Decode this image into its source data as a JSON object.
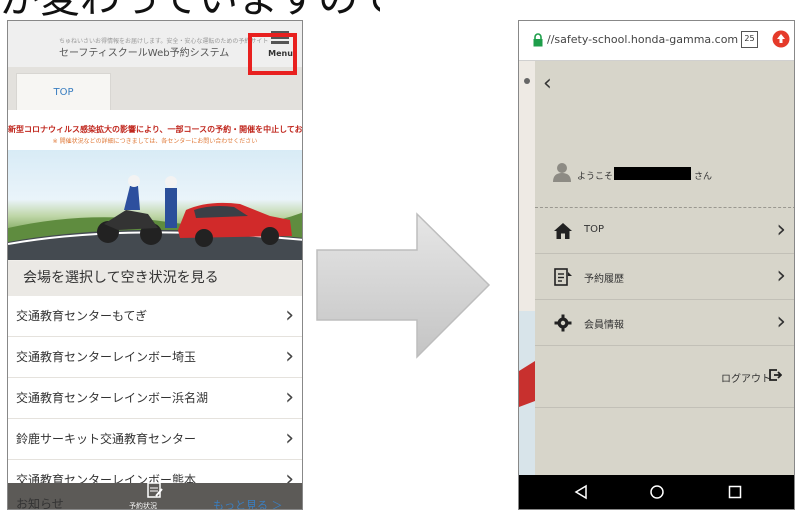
{
  "caption": "が変わっていますのでご注意ください。",
  "left_phone": {
    "logo_small": "ちゅねいさいお得情報をお届けします。安全・安心な運転のための予約サイト",
    "logo": "セーフティスクールWeb予約システム",
    "menu_label": "Menu",
    "tab_top": "TOP",
    "notice_main": "新型コロナウィルス感染拡大の影響により、一部コースの予約・開催を中止しております",
    "notice_sub": "※ 開催状況などの詳細につきましては、各センターにお問い合わせください",
    "section_title": "会場を選択して空き状況を見る",
    "venues": [
      {
        "name": "交通教育センターもてぎ"
      },
      {
        "name": "交通教育センターレインボー埼玉"
      },
      {
        "name": "交通教育センターレインボー浜名湖"
      },
      {
        "name": "鈴鹿サーキット交通教育センター"
      },
      {
        "name": "交通教育センターレインボー熊本"
      }
    ],
    "footer": {
      "news": "お知らせ",
      "status": "予約状況",
      "more": "もっと見る ＞"
    }
  },
  "right_phone": {
    "url": "//safety-school.honda-gamma.com",
    "tab_count": "25",
    "welcome_prefix": "ようこそ",
    "welcome_suffix": "さん",
    "menu_items": [
      {
        "label": "TOP",
        "icon": "home-icon"
      },
      {
        "label": "予約履歴",
        "icon": "history-icon"
      },
      {
        "label": "会員情報",
        "icon": "gear-icon"
      }
    ],
    "logout_label": "ログアウト"
  },
  "colors": {
    "highlight": "#e8201f",
    "drawer_bg": "#d7d5ca",
    "link_blue": "#3a7ec0",
    "notice_red": "#c0271e",
    "url_lock": "#1e9e4a",
    "upload_red": "#e53a2a"
  }
}
